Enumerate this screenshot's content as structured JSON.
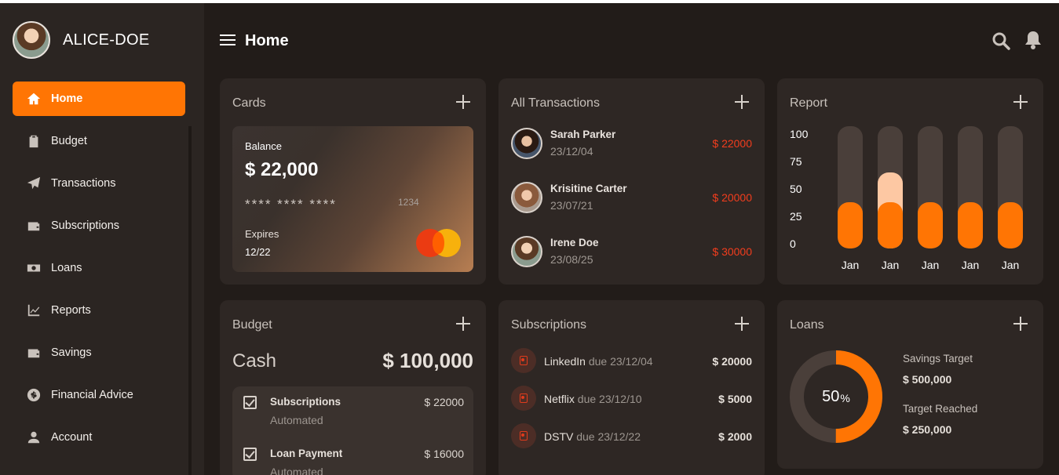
{
  "colors": {
    "accent": "#ff7504",
    "negative": "#f23d1d",
    "bg": "#221c19",
    "panel": "#2e2724"
  },
  "user": {
    "name": "ALICE-DOE"
  },
  "header": {
    "title": "Home"
  },
  "sidebar": {
    "items": [
      {
        "label": "Home",
        "icon": "home-icon",
        "active": true
      },
      {
        "label": "Budget",
        "icon": "clipboard-icon"
      },
      {
        "label": "Transactions",
        "icon": "paper-plane-icon"
      },
      {
        "label": "Subscriptions",
        "icon": "wallet-icon"
      },
      {
        "label": "Loans",
        "icon": "money-icon"
      },
      {
        "label": "Reports",
        "icon": "chart-line-icon"
      },
      {
        "label": "Savings",
        "icon": "wallet-icon"
      },
      {
        "label": "Financial Advice",
        "icon": "dollar-badge-icon"
      },
      {
        "label": "Account",
        "icon": "user-icon"
      }
    ]
  },
  "cards": {
    "title": "Cards",
    "balance_label": "Balance",
    "balance": "$ 22,000",
    "masked": "**** **** ****",
    "last4": "1234",
    "expires_label": "Expires",
    "expires": "12/22"
  },
  "transactions": {
    "title": "All Transactions",
    "items": [
      {
        "name": "Sarah Parker",
        "date": "23/12/04",
        "amount": "$ 22000"
      },
      {
        "name": "Krisitine Carter",
        "date": "23/07/21",
        "amount": "$ 20000"
      },
      {
        "name": "Irene Doe",
        "date": "23/08/25",
        "amount": "$ 30000"
      }
    ]
  },
  "report": {
    "title": "Report",
    "chart_data": {
      "type": "bar",
      "categories": [
        "Jan",
        "Jan",
        "Jan",
        "Jan",
        "Jan"
      ],
      "values": [
        38,
        38,
        38,
        38,
        38
      ],
      "highlight": [
        0,
        62,
        0,
        0,
        0
      ],
      "yticks": [
        100,
        75,
        50,
        25,
        0
      ],
      "ylim": [
        0,
        100
      ]
    }
  },
  "budget": {
    "title": "Budget",
    "cash_label": "Cash",
    "cash_amount": "$ 100,000",
    "items": [
      {
        "name": "Subscriptions",
        "sub": "Automated",
        "amount": "$ 22000"
      },
      {
        "name": "Loan Payment",
        "sub": "Automated",
        "amount": "$ 16000"
      }
    ]
  },
  "subscriptions": {
    "title": "Subscriptions",
    "items": [
      {
        "name": "LinkedIn",
        "due": "due 23/12/04",
        "amount": "$ 20000"
      },
      {
        "name": "Netflix",
        "due": "due 23/12/10",
        "amount": "$ 5000"
      },
      {
        "name": "DSTV",
        "due": "due 23/12/22",
        "amount": "$ 2000"
      }
    ]
  },
  "loans": {
    "title": "Loans",
    "percent_value": 50,
    "percent": "50",
    "percent_sign": "%",
    "savings_target_label": "Savings Target",
    "savings_target": "$ 500,000",
    "target_reached_label": "Target Reached",
    "target_reached": "$ 250,000"
  }
}
